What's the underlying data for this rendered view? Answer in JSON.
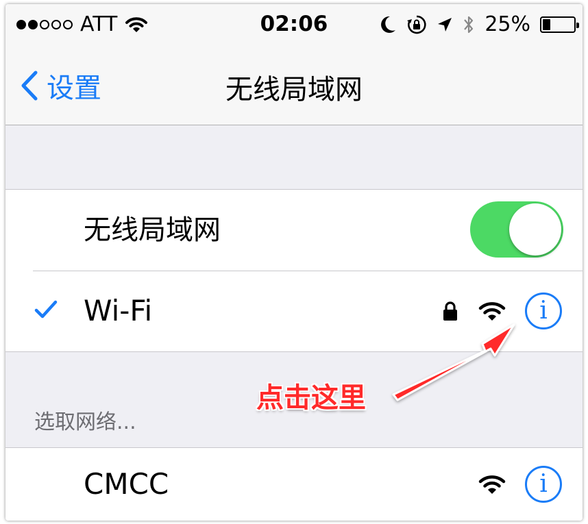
{
  "status_bar": {
    "signal_filled": 2,
    "signal_total": 5,
    "carrier": "ATT",
    "time": "02:06",
    "battery_text": "25%",
    "battery_level": 0.25
  },
  "nav": {
    "back_label": "设置",
    "title": "无线局域网"
  },
  "wlan_group": {
    "toggle_label": "无线局域网",
    "toggle_on": true,
    "connected_network": "Wi-Fi",
    "connected_secured": true
  },
  "networks_section": {
    "header": "选取网络...",
    "networks": [
      {
        "name": "CMCC",
        "secured": false
      }
    ]
  },
  "annotation": {
    "text": "点击这里",
    "color": "#ff2a2a"
  },
  "colors": {
    "accent": "#1a7cf7",
    "toggle_on": "#4cd964",
    "background": "#efeff4"
  }
}
